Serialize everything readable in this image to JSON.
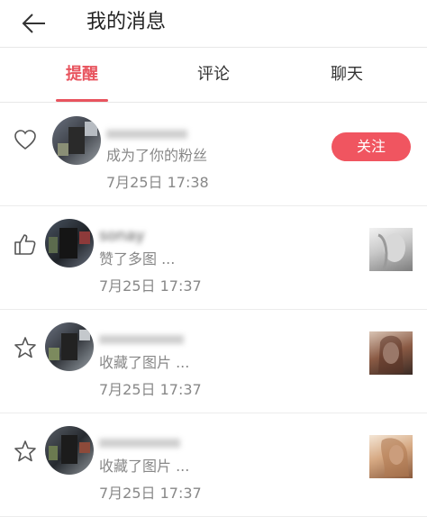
{
  "header": {
    "title": "我的消息"
  },
  "tabs": [
    {
      "label": "提醒",
      "active": true
    },
    {
      "label": "评论",
      "active": false
    },
    {
      "label": "聊天",
      "active": false
    }
  ],
  "notifications": [
    {
      "type": "follow",
      "icon": "heart-icon",
      "username": "",
      "action": "成为了你的粉丝",
      "time": "7月25日 17:38",
      "button_label": "关注"
    },
    {
      "type": "like",
      "icon": "thumbs-up-icon",
      "username": "sonay",
      "action": "赞了多图 ...",
      "time": "7月25日 17:37"
    },
    {
      "type": "collect",
      "icon": "star-icon",
      "username": "",
      "action": "收藏了图片 ...",
      "time": "7月25日 17:37"
    },
    {
      "type": "collect",
      "icon": "star-icon",
      "username": "",
      "action": "收藏了图片 ...",
      "time": "7月25日 17:37"
    }
  ],
  "colors": {
    "accent": "#e8545e",
    "follow_button": "#f05560",
    "text_secondary": "#888888"
  }
}
